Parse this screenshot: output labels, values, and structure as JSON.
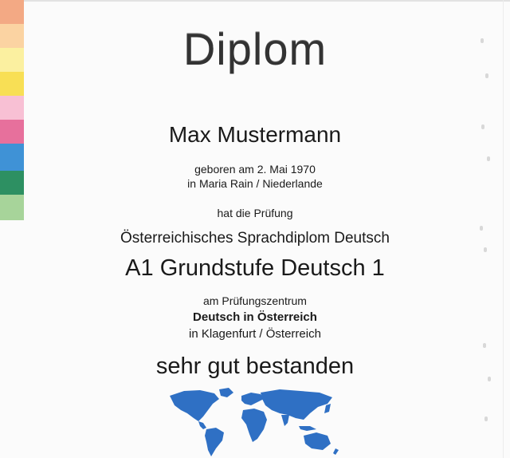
{
  "stripe_colors": [
    "#f3a984",
    "#fbd3a2",
    "#fbf0a0",
    "#f8df55",
    "#f8c0d4",
    "#e7709c",
    "#3f92d6",
    "#2d9062",
    "#a7d49a"
  ],
  "map_color": "#2f70c4",
  "diploma": {
    "title": "Diplom",
    "name": "Max Mustermann",
    "birth_line": "geboren am 2. Mai 1970",
    "birth_place": "in Maria Rain / Niederlande",
    "intro": "hat die Prüfung",
    "exam_name": "Österreichisches Sprachdiplom Deutsch",
    "level": "A1 Grundstufe Deutsch 1",
    "center_label": "am Prüfungszentrum",
    "center_name": "Deutsch in Österreich",
    "center_city": "in Klagenfurt / Österreich",
    "result": "sehr gut bestanden"
  }
}
